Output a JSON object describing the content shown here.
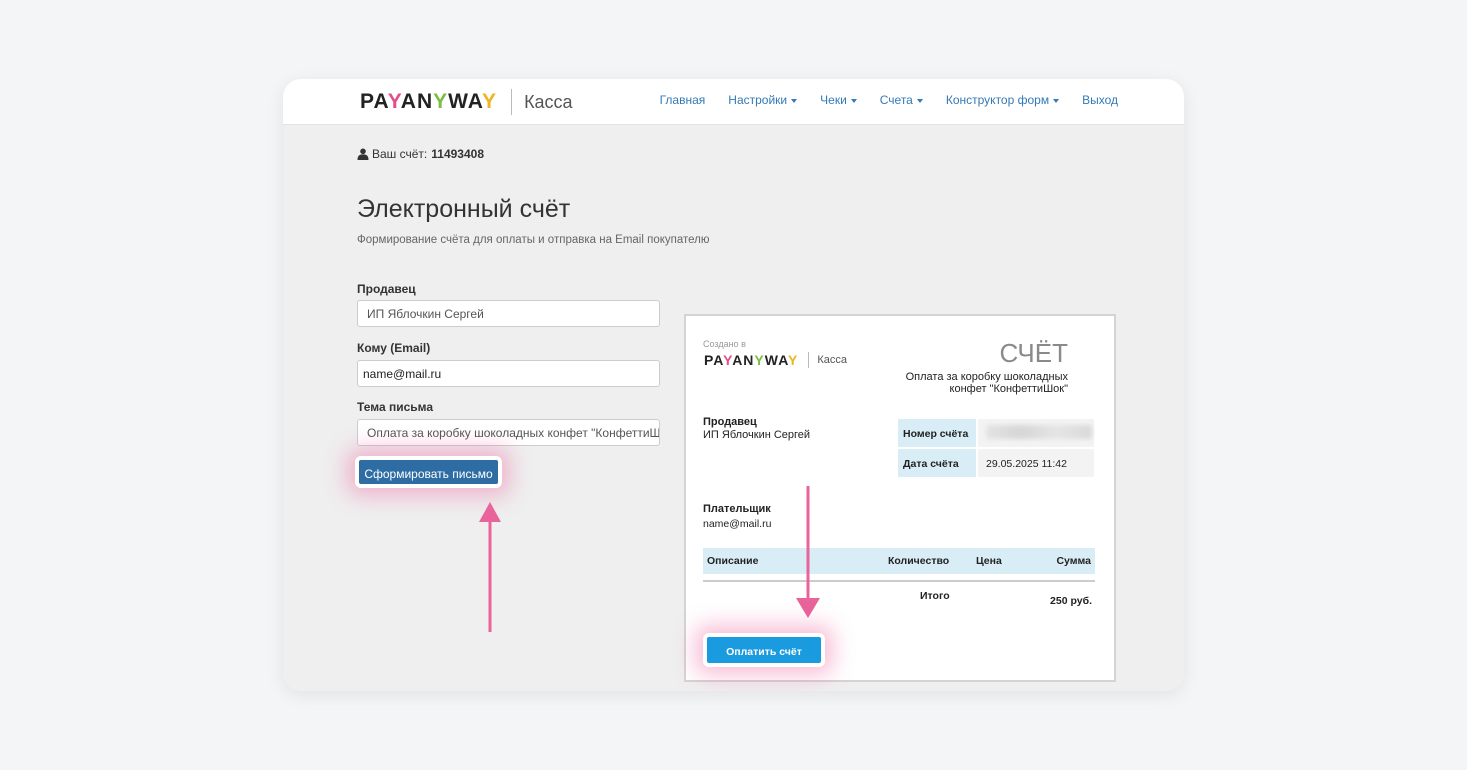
{
  "brand": {
    "logo_text": "PAYANYWAY",
    "product": "Касса"
  },
  "nav": [
    {
      "label": "Главная",
      "dropdown": false
    },
    {
      "label": "Настройки",
      "dropdown": true
    },
    {
      "label": "Чеки",
      "dropdown": true
    },
    {
      "label": "Счета",
      "dropdown": true
    },
    {
      "label": "Конструктор форм",
      "dropdown": true
    },
    {
      "label": "Выход",
      "dropdown": false
    }
  ],
  "account": {
    "label": "Ваш счёт:",
    "number": "11493408"
  },
  "page": {
    "title": "Электронный счёт",
    "subtitle": "Формирование счёта для оплаты и отправка на Email покупателю"
  },
  "form": {
    "seller_label": "Продавец",
    "seller_value": "ИП Яблочкин Сергей",
    "to_label": "Кому (Email)",
    "to_value": "name@mail.ru",
    "subject_label": "Тема письма",
    "subject_value": "Оплата за коробку шоколадных конфет \"КонфеттиШок\"",
    "submit_label": "Сформировать письмо"
  },
  "invoice": {
    "created_in": "Создано в",
    "title": "СЧЁТ",
    "description": "Оплата за коробку шоколадных конфет \"КонфеттиШок\"",
    "seller_label": "Продавец",
    "seller_value": "ИП Яблочкин Сергей",
    "number_label": "Номер счёта",
    "date_label": "Дата счёта",
    "date_value": "29.05.2025 11:42",
    "payer_label": "Плательщик",
    "payer_value": "name@mail.ru",
    "columns": [
      "Описание",
      "Количество",
      "Цена",
      "Сумма"
    ],
    "total_label": "Итого",
    "total_value": "250 руб.",
    "pay_button": "Оплатить счёт"
  },
  "colors": {
    "accent_blue": "#2e6da4",
    "pay_blue": "#1a9be0",
    "highlight_pink": "#e8649a",
    "nav_link": "#337ab7"
  }
}
